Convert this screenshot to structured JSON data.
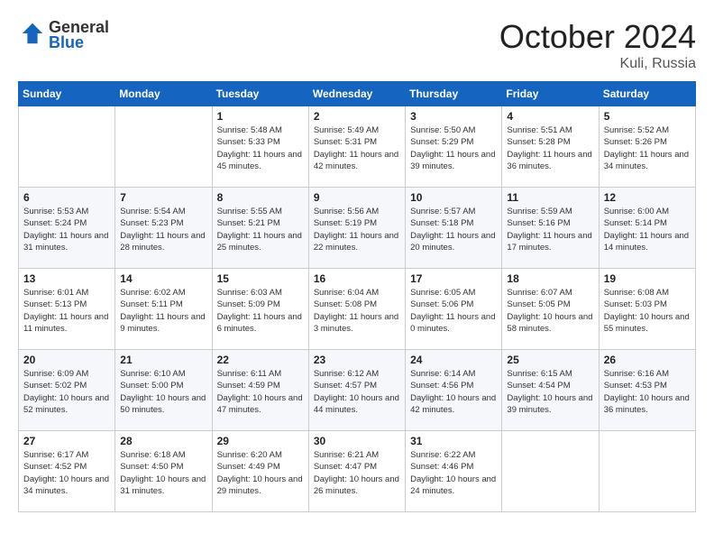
{
  "logo": {
    "general": "General",
    "blue": "Blue"
  },
  "header": {
    "month": "October 2024",
    "location": "Kuli, Russia"
  },
  "weekdays": [
    "Sunday",
    "Monday",
    "Tuesday",
    "Wednesday",
    "Thursday",
    "Friday",
    "Saturday"
  ],
  "weeks": [
    [
      {
        "num": "",
        "info": ""
      },
      {
        "num": "",
        "info": ""
      },
      {
        "num": "1",
        "info": "Sunrise: 5:48 AM\nSunset: 5:33 PM\nDaylight: 11 hours and 45 minutes."
      },
      {
        "num": "2",
        "info": "Sunrise: 5:49 AM\nSunset: 5:31 PM\nDaylight: 11 hours and 42 minutes."
      },
      {
        "num": "3",
        "info": "Sunrise: 5:50 AM\nSunset: 5:29 PM\nDaylight: 11 hours and 39 minutes."
      },
      {
        "num": "4",
        "info": "Sunrise: 5:51 AM\nSunset: 5:28 PM\nDaylight: 11 hours and 36 minutes."
      },
      {
        "num": "5",
        "info": "Sunrise: 5:52 AM\nSunset: 5:26 PM\nDaylight: 11 hours and 34 minutes."
      }
    ],
    [
      {
        "num": "6",
        "info": "Sunrise: 5:53 AM\nSunset: 5:24 PM\nDaylight: 11 hours and 31 minutes."
      },
      {
        "num": "7",
        "info": "Sunrise: 5:54 AM\nSunset: 5:23 PM\nDaylight: 11 hours and 28 minutes."
      },
      {
        "num": "8",
        "info": "Sunrise: 5:55 AM\nSunset: 5:21 PM\nDaylight: 11 hours and 25 minutes."
      },
      {
        "num": "9",
        "info": "Sunrise: 5:56 AM\nSunset: 5:19 PM\nDaylight: 11 hours and 22 minutes."
      },
      {
        "num": "10",
        "info": "Sunrise: 5:57 AM\nSunset: 5:18 PM\nDaylight: 11 hours and 20 minutes."
      },
      {
        "num": "11",
        "info": "Sunrise: 5:59 AM\nSunset: 5:16 PM\nDaylight: 11 hours and 17 minutes."
      },
      {
        "num": "12",
        "info": "Sunrise: 6:00 AM\nSunset: 5:14 PM\nDaylight: 11 hours and 14 minutes."
      }
    ],
    [
      {
        "num": "13",
        "info": "Sunrise: 6:01 AM\nSunset: 5:13 PM\nDaylight: 11 hours and 11 minutes."
      },
      {
        "num": "14",
        "info": "Sunrise: 6:02 AM\nSunset: 5:11 PM\nDaylight: 11 hours and 9 minutes."
      },
      {
        "num": "15",
        "info": "Sunrise: 6:03 AM\nSunset: 5:09 PM\nDaylight: 11 hours and 6 minutes."
      },
      {
        "num": "16",
        "info": "Sunrise: 6:04 AM\nSunset: 5:08 PM\nDaylight: 11 hours and 3 minutes."
      },
      {
        "num": "17",
        "info": "Sunrise: 6:05 AM\nSunset: 5:06 PM\nDaylight: 11 hours and 0 minutes."
      },
      {
        "num": "18",
        "info": "Sunrise: 6:07 AM\nSunset: 5:05 PM\nDaylight: 10 hours and 58 minutes."
      },
      {
        "num": "19",
        "info": "Sunrise: 6:08 AM\nSunset: 5:03 PM\nDaylight: 10 hours and 55 minutes."
      }
    ],
    [
      {
        "num": "20",
        "info": "Sunrise: 6:09 AM\nSunset: 5:02 PM\nDaylight: 10 hours and 52 minutes."
      },
      {
        "num": "21",
        "info": "Sunrise: 6:10 AM\nSunset: 5:00 PM\nDaylight: 10 hours and 50 minutes."
      },
      {
        "num": "22",
        "info": "Sunrise: 6:11 AM\nSunset: 4:59 PM\nDaylight: 10 hours and 47 minutes."
      },
      {
        "num": "23",
        "info": "Sunrise: 6:12 AM\nSunset: 4:57 PM\nDaylight: 10 hours and 44 minutes."
      },
      {
        "num": "24",
        "info": "Sunrise: 6:14 AM\nSunset: 4:56 PM\nDaylight: 10 hours and 42 minutes."
      },
      {
        "num": "25",
        "info": "Sunrise: 6:15 AM\nSunset: 4:54 PM\nDaylight: 10 hours and 39 minutes."
      },
      {
        "num": "26",
        "info": "Sunrise: 6:16 AM\nSunset: 4:53 PM\nDaylight: 10 hours and 36 minutes."
      }
    ],
    [
      {
        "num": "27",
        "info": "Sunrise: 6:17 AM\nSunset: 4:52 PM\nDaylight: 10 hours and 34 minutes."
      },
      {
        "num": "28",
        "info": "Sunrise: 6:18 AM\nSunset: 4:50 PM\nDaylight: 10 hours and 31 minutes."
      },
      {
        "num": "29",
        "info": "Sunrise: 6:20 AM\nSunset: 4:49 PM\nDaylight: 10 hours and 29 minutes."
      },
      {
        "num": "30",
        "info": "Sunrise: 6:21 AM\nSunset: 4:47 PM\nDaylight: 10 hours and 26 minutes."
      },
      {
        "num": "31",
        "info": "Sunrise: 6:22 AM\nSunset: 4:46 PM\nDaylight: 10 hours and 24 minutes."
      },
      {
        "num": "",
        "info": ""
      },
      {
        "num": "",
        "info": ""
      }
    ]
  ]
}
